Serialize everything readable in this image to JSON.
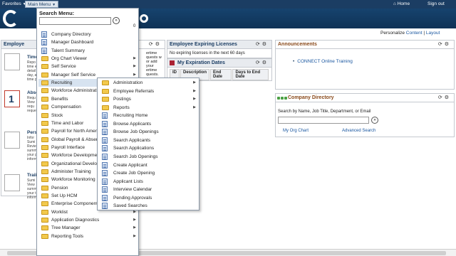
{
  "topbar": {
    "favorites": "Favorites",
    "main_menu": "Main Menu",
    "home": "Home",
    "sign_out": "Sign out"
  },
  "personalize": {
    "prefix": "Personalize",
    "content": "Content",
    "sep": "|",
    "layout": "Layout"
  },
  "employee_pagelet": {
    "title": "Employe",
    "tiles": [
      {
        "title": "Time",
        "desc": "Repo time e detail day, a time p"
      },
      {
        "title": "Abse",
        "desc": "Requ View requ reque"
      },
      {
        "title": "Pers",
        "desc": "Infor Sumi Revie summ your p inform"
      },
      {
        "title": "Traii",
        "desc": "Sumi View summ your t inform"
      }
    ]
  },
  "mid_pagelet": {
    "desc": "ertime quests w or add your ertime quests."
  },
  "expiring": {
    "title": "Employee Expiring Licenses",
    "message": "No expiring licenses in the next 60 days"
  },
  "expiration": {
    "title": "My Expiration Dates",
    "columns": [
      "ID",
      "Description",
      "End Date",
      "Days to End Date"
    ]
  },
  "announcements": {
    "title": "Announcements",
    "items": [
      "CONNECT Online Training"
    ]
  },
  "company_directory": {
    "title": "Company Directory",
    "search_label": "Search by Name, Job Title, Department, or Email",
    "org_chart": "My Org Chart",
    "advanced": "Advanced Search"
  },
  "search_menu": {
    "title": "Search Menu:",
    "count": "0",
    "items": [
      {
        "label": "Company Directory",
        "icon": "doc",
        "sub": false
      },
      {
        "label": "Manager Dashboard",
        "icon": "doc",
        "sub": false
      },
      {
        "label": "Talent Summary",
        "icon": "doc",
        "sub": false
      },
      {
        "label": "Org Chart Viewer",
        "icon": "folder",
        "sub": true
      },
      {
        "label": "Self Service",
        "icon": "folder",
        "sub": true
      },
      {
        "label": "Manager Self Service",
        "icon": "folder",
        "sub": true
      },
      {
        "label": "Recruiting",
        "icon": "folder",
        "sub": true
      },
      {
        "label": "Workforce Administratio",
        "icon": "folder",
        "sub": true
      },
      {
        "label": "Benefits",
        "icon": "folder",
        "sub": true
      },
      {
        "label": "Compensation",
        "icon": "folder",
        "sub": true
      },
      {
        "label": "Stock",
        "icon": "folder",
        "sub": true
      },
      {
        "label": "Time and Labor",
        "icon": "folder",
        "sub": true
      },
      {
        "label": "Payroll for North Americ",
        "icon": "folder",
        "sub": true
      },
      {
        "label": "Global Payroll & Absenc",
        "icon": "folder",
        "sub": true
      },
      {
        "label": "Payroll Interface",
        "icon": "folder",
        "sub": true
      },
      {
        "label": "Workforce Developmen",
        "icon": "folder",
        "sub": true
      },
      {
        "label": "Organizational Develop",
        "icon": "folder",
        "sub": true
      },
      {
        "label": "Administer Training",
        "icon": "folder",
        "sub": true
      },
      {
        "label": "Workforce Monitoring",
        "icon": "folder",
        "sub": true
      },
      {
        "label": "Pension",
        "icon": "folder",
        "sub": true
      },
      {
        "label": "Set Up HCM",
        "icon": "folder",
        "sub": true
      },
      {
        "label": "Enterprise Components",
        "icon": "folder",
        "sub": true
      },
      {
        "label": "Worklist",
        "icon": "folder",
        "sub": true
      },
      {
        "label": "Application Diagnostics",
        "icon": "folder",
        "sub": true
      },
      {
        "label": "Tree Manager",
        "icon": "folder",
        "sub": true
      },
      {
        "label": "Reporting Tools",
        "icon": "folder",
        "sub": true
      }
    ]
  },
  "recruiting_menu": {
    "items": [
      {
        "label": "Administration",
        "icon": "folder",
        "sub": true
      },
      {
        "label": "Employee Referrals",
        "icon": "folder",
        "sub": true
      },
      {
        "label": "Postings",
        "icon": "folder",
        "sub": true
      },
      {
        "label": "Reports",
        "icon": "folder",
        "sub": true
      },
      {
        "label": "Recruiting Home",
        "icon": "doc",
        "sub": false
      },
      {
        "label": "Browse Applicants",
        "icon": "doc",
        "sub": false
      },
      {
        "label": "Browse Job Openings",
        "icon": "doc",
        "sub": false
      },
      {
        "label": "Search Applicants",
        "icon": "doc",
        "sub": false
      },
      {
        "label": "Search Applications",
        "icon": "doc",
        "sub": false
      },
      {
        "label": "Search Job Openings",
        "icon": "doc",
        "sub": false
      },
      {
        "label": "Create Applicant",
        "icon": "doc",
        "sub": false
      },
      {
        "label": "Create Job Opening",
        "icon": "doc",
        "sub": false
      },
      {
        "label": "Applicant Lists",
        "icon": "doc",
        "sub": false
      },
      {
        "label": "Interview Calendar",
        "icon": "doc",
        "sub": false
      },
      {
        "label": "Pending Approvals",
        "icon": "doc",
        "sub": false
      },
      {
        "label": "Saved Searches",
        "icon": "doc",
        "sub": false
      }
    ]
  },
  "colors": {
    "header_bg": "#1b3d63",
    "link": "#1a57a0",
    "highlight": "#d7e3f0"
  }
}
